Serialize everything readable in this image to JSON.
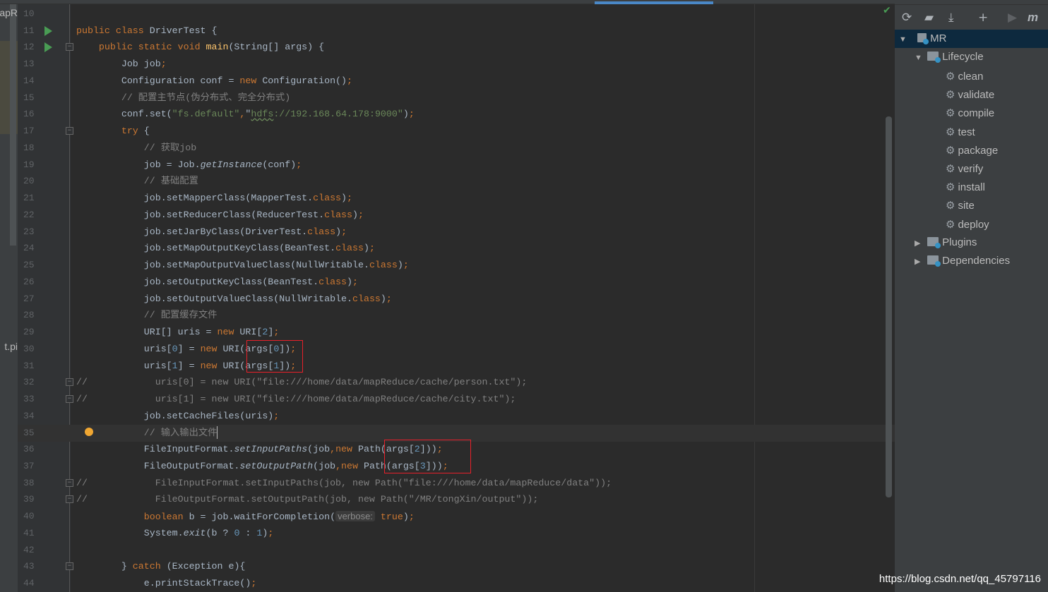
{
  "left_panel": {
    "labels": [
      "apR",
      "t.pi"
    ]
  },
  "code_lines": [
    {
      "n": "10",
      "t": []
    },
    {
      "n": "11",
      "run": true,
      "t": [
        [
          "public class ",
          "k"
        ],
        [
          "DriverTest {",
          ""
        ]
      ]
    },
    {
      "n": "12",
      "run": true,
      "fold": true,
      "t": [
        [
          "    public static void ",
          "k"
        ],
        [
          "main",
          "f"
        ],
        [
          "(String[] args) {",
          ""
        ]
      ]
    },
    {
      "n": "13",
      "t": [
        [
          "        Job job",
          ""
        ],
        [
          ";",
          "k"
        ]
      ]
    },
    {
      "n": "14",
      "t": [
        [
          "        Configuration conf = ",
          ""
        ],
        [
          "new ",
          "k"
        ],
        [
          "Configuration()",
          ""
        ],
        [
          ";",
          "k"
        ]
      ]
    },
    {
      "n": "15",
      "t": [
        [
          "        // 配置主节点(伪分布式、完全分布式)",
          "c"
        ]
      ]
    },
    {
      "n": "16",
      "t": [
        [
          "        conf.set(",
          ""
        ],
        [
          "\"fs.default\"",
          "s"
        ],
        [
          ",",
          "k"
        ],
        [
          "\"",
          ""
        ],
        [
          "hdfs",
          "s u"
        ],
        [
          "://192.168.64.178:9000\"",
          "s"
        ],
        [
          ")",
          ""
        ],
        [
          ";",
          "k"
        ]
      ]
    },
    {
      "n": "17",
      "fold": true,
      "t": [
        [
          "        try ",
          "k"
        ],
        [
          "{",
          ""
        ]
      ]
    },
    {
      "n": "18",
      "t": [
        [
          "            // 获取job",
          "c"
        ]
      ]
    },
    {
      "n": "19",
      "t": [
        [
          "            job = Job.",
          ""
        ],
        [
          "getInstance",
          "i"
        ],
        [
          "(conf)",
          ""
        ],
        [
          ";",
          "k"
        ]
      ]
    },
    {
      "n": "20",
      "t": [
        [
          "            // 基础配置",
          "c"
        ]
      ]
    },
    {
      "n": "21",
      "t": [
        [
          "            job.setMapperClass(MapperTest.",
          ""
        ],
        [
          "class",
          "k"
        ],
        [
          ")",
          ""
        ],
        [
          ";",
          "k"
        ]
      ]
    },
    {
      "n": "22",
      "t": [
        [
          "            job.setReducerClass(ReducerTest.",
          ""
        ],
        [
          "class",
          "k"
        ],
        [
          ")",
          ""
        ],
        [
          ";",
          "k"
        ]
      ]
    },
    {
      "n": "23",
      "t": [
        [
          "            job.setJarByClass(DriverTest.",
          ""
        ],
        [
          "class",
          "k"
        ],
        [
          ")",
          ""
        ],
        [
          ";",
          "k"
        ]
      ]
    },
    {
      "n": "24",
      "t": [
        [
          "            job.setMapOutputKeyClass(BeanTest.",
          ""
        ],
        [
          "class",
          "k"
        ],
        [
          ")",
          ""
        ],
        [
          ";",
          "k"
        ]
      ]
    },
    {
      "n": "25",
      "t": [
        [
          "            job.setMapOutputValueClass(NullWritable.",
          ""
        ],
        [
          "class",
          "k"
        ],
        [
          ")",
          ""
        ],
        [
          ";",
          "k"
        ]
      ]
    },
    {
      "n": "26",
      "t": [
        [
          "            job.setOutputKeyClass(BeanTest.",
          ""
        ],
        [
          "class",
          "k"
        ],
        [
          ")",
          ""
        ],
        [
          ";",
          "k"
        ]
      ]
    },
    {
      "n": "27",
      "t": [
        [
          "            job.setOutputValueClass(NullWritable.",
          ""
        ],
        [
          "class",
          "k"
        ],
        [
          ")",
          ""
        ],
        [
          ";",
          "k"
        ]
      ]
    },
    {
      "n": "28",
      "t": [
        [
          "            // 配置缓存文件",
          "c"
        ]
      ]
    },
    {
      "n": "29",
      "t": [
        [
          "            URI[] uris = ",
          ""
        ],
        [
          "new ",
          "k"
        ],
        [
          "URI[",
          ""
        ],
        [
          "2",
          "n"
        ],
        [
          "]",
          ""
        ],
        [
          ";",
          "k"
        ]
      ]
    },
    {
      "n": "30",
      "t": [
        [
          "            uris[",
          ""
        ],
        [
          "0",
          "n"
        ],
        [
          "] = ",
          ""
        ],
        [
          "new ",
          "k"
        ],
        [
          "URI(args[",
          ""
        ],
        [
          "0",
          "n"
        ],
        [
          "])",
          ""
        ],
        [
          ";",
          "k"
        ]
      ]
    },
    {
      "n": "31",
      "t": [
        [
          "            uris[",
          ""
        ],
        [
          "1",
          "n"
        ],
        [
          "] = ",
          ""
        ],
        [
          "new ",
          "k"
        ],
        [
          "URI(args[",
          ""
        ],
        [
          "1",
          "n"
        ],
        [
          "])",
          ""
        ],
        [
          ";",
          "k"
        ]
      ]
    },
    {
      "n": "32",
      "fold": true,
      "t": [
        [
          "//            uris[0] = new URI(\"file:///home/data/mapReduce/cache/person.txt\");",
          "c"
        ]
      ]
    },
    {
      "n": "33",
      "fold": true,
      "t": [
        [
          "//            uris[1] = new URI(\"file:///home/data/mapReduce/cache/city.txt\");",
          "c"
        ]
      ]
    },
    {
      "n": "34",
      "t": [
        [
          "            job.setCacheFiles(uris)",
          ""
        ],
        [
          ";",
          "k"
        ]
      ]
    },
    {
      "n": "35",
      "cur": true,
      "bulb": true,
      "t": [
        [
          "            // 输入输出文件",
          "c"
        ]
      ]
    },
    {
      "n": "36",
      "t": [
        [
          "            FileInputFormat.",
          ""
        ],
        [
          "setInputPaths",
          "i"
        ],
        [
          "(job",
          ""
        ],
        [
          ",",
          "k"
        ],
        [
          "new ",
          "k"
        ],
        [
          "Path(args[",
          ""
        ],
        [
          "2",
          "n"
        ],
        [
          "]))",
          ""
        ],
        [
          ";",
          "k"
        ]
      ]
    },
    {
      "n": "37",
      "t": [
        [
          "            FileOutputFormat.",
          ""
        ],
        [
          "setOutputPath",
          "i"
        ],
        [
          "(job",
          ""
        ],
        [
          ",",
          "k"
        ],
        [
          "new ",
          "k"
        ],
        [
          "Path(args[",
          ""
        ],
        [
          "3",
          "n"
        ],
        [
          "]))",
          ""
        ],
        [
          ";",
          "k"
        ]
      ]
    },
    {
      "n": "38",
      "fold": true,
      "t": [
        [
          "//            FileInputFormat.setInputPaths(job, new Path(\"file:///home/data/mapReduce/data\"));",
          "c"
        ]
      ]
    },
    {
      "n": "39",
      "fold": true,
      "t": [
        [
          "//            FileOutputFormat.setOutputPath(job, new Path(\"/MR/tongXin/output\"));",
          "c"
        ]
      ]
    },
    {
      "n": "40",
      "t": [
        [
          "            boolean ",
          "k"
        ],
        [
          "b = job.waitForCompletion(",
          ""
        ],
        [
          "verbose:",
          "h"
        ],
        [
          " true",
          "k"
        ],
        [
          ")",
          ""
        ],
        [
          ";",
          "k"
        ]
      ]
    },
    {
      "n": "41",
      "t": [
        [
          "            System.",
          ""
        ],
        [
          "exit",
          "i"
        ],
        [
          "(b ? ",
          ""
        ],
        [
          "0",
          "n"
        ],
        [
          " : ",
          ""
        ],
        [
          "1",
          "n"
        ],
        [
          ")",
          ""
        ],
        [
          ";",
          "k"
        ]
      ]
    },
    {
      "n": "42",
      "t": []
    },
    {
      "n": "43",
      "fold": true,
      "t": [
        [
          "        } ",
          ""
        ],
        [
          "catch ",
          "k"
        ],
        [
          "(Exception e){",
          ""
        ]
      ]
    },
    {
      "n": "44",
      "t": [
        [
          "            e.printStackTrace()",
          ""
        ],
        [
          ";",
          "k"
        ]
      ]
    }
  ],
  "maven_panel": {
    "toolbar": [
      "refresh-icon",
      "reimport-folder-icon",
      "download-icon",
      "add-icon",
      "run-icon",
      "maven-icon"
    ],
    "project": "MR",
    "lifecycle_label": "Lifecycle",
    "lifecycle": [
      "clean",
      "validate",
      "compile",
      "test",
      "package",
      "verify",
      "install",
      "site",
      "deploy"
    ],
    "plugins_label": "Plugins",
    "dependencies_label": "Dependencies"
  },
  "watermark": "https://blog.csdn.net/qq_45797116",
  "colors": {
    "keyword": "#cc7832",
    "string": "#6a8759",
    "comment": "#808080",
    "number": "#6897bb",
    "annotation_box": "#e8202a"
  }
}
